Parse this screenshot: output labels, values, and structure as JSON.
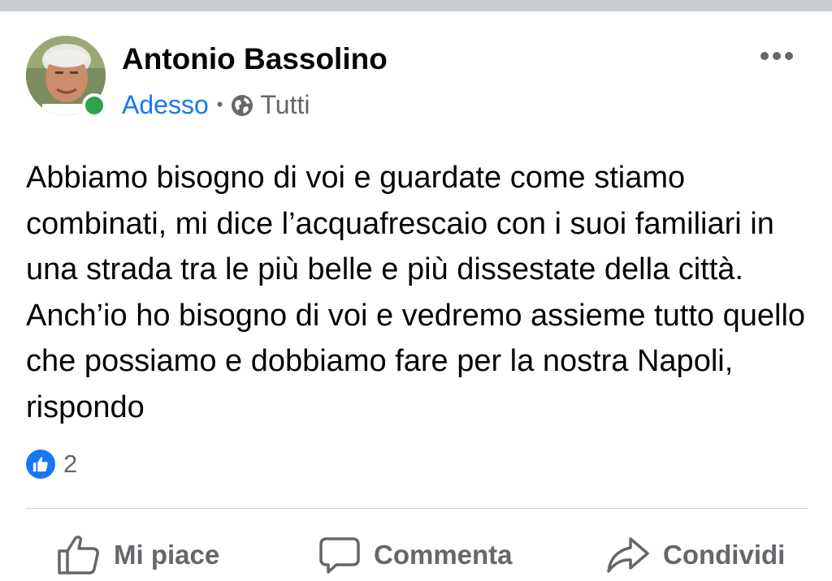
{
  "post": {
    "author": "Antonio Bassolino",
    "time": "Adesso",
    "separator": "•",
    "audience": "Tutti",
    "text": "Abbiamo bisogno di voi e guardate come stiamo combinati, mi dice l’acquafrescaio con i suoi familiari in una strada tra le più belle e più dissestate della città. Anch’io ho bisogno di voi e vedremo assieme tutto quello che possiamo e dobbiamo fare per la nostra Napoli, rispondo",
    "reactions": {
      "icon": "like-icon",
      "count": "2"
    },
    "online": true
  },
  "actions": {
    "like_label": "Mi piace",
    "comment_label": "Commenta",
    "share_label": "Condividi"
  },
  "colors": {
    "accent": "#1877f2",
    "secondary_text": "#65676b",
    "online": "#31a24c",
    "divider": "#ced0d4"
  }
}
